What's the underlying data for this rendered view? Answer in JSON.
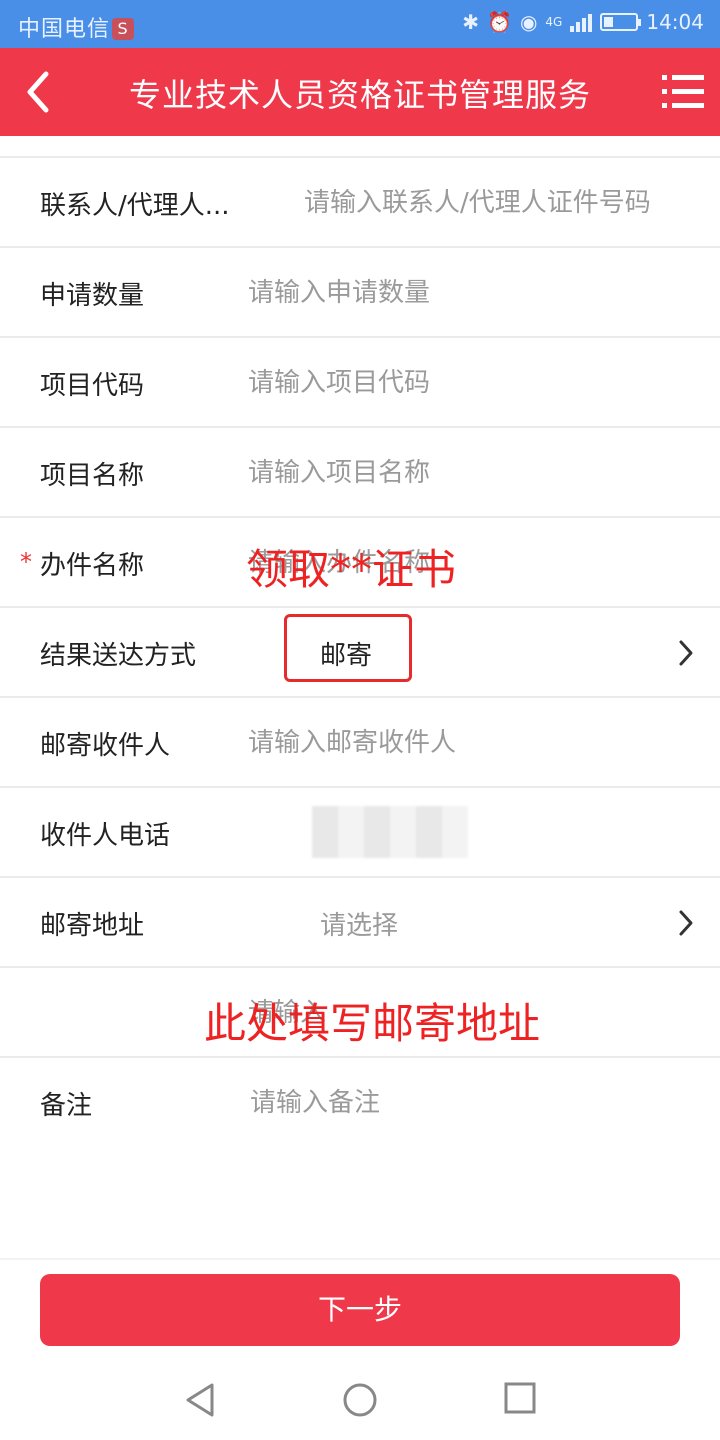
{
  "status_bar": {
    "carrier": "中国电信",
    "carrier_badge": "S",
    "network": "4G",
    "battery_level": 0.3,
    "time": "14:04"
  },
  "nav": {
    "title": "专业技术人员资格证书管理服务"
  },
  "form": {
    "rows": [
      {
        "label": "联系人/代理人...",
        "placeholder": "请输入联系人/代理人证件号码"
      },
      {
        "label": "申请数量",
        "placeholder": "请输入申请数量"
      },
      {
        "label": "项目代码",
        "placeholder": "请输入项目代码"
      },
      {
        "label": "项目名称",
        "placeholder": "请输入项目名称"
      },
      {
        "label": "办件名称",
        "placeholder": "请输入办件名称",
        "required": "*"
      },
      {
        "label": "结果送达方式",
        "value": "邮寄"
      },
      {
        "label": "邮寄收件人",
        "placeholder": "请输入邮寄收件人"
      },
      {
        "label": "收件人电话"
      },
      {
        "label": "邮寄地址",
        "value": "请选择"
      },
      {
        "label": "",
        "placeholder": "请输入"
      },
      {
        "label": "备注",
        "placeholder": "请输入备注"
      }
    ]
  },
  "annotations": {
    "case_name": "领取**证书",
    "address_hint": "此处填写邮寄地址"
  },
  "footer": {
    "next_label": "下一步"
  },
  "colors": {
    "status_bar": "#4a8fe7",
    "nav_bar": "#f0384b",
    "annotation": "#ee2222",
    "placeholder": "#9a9a9a"
  }
}
